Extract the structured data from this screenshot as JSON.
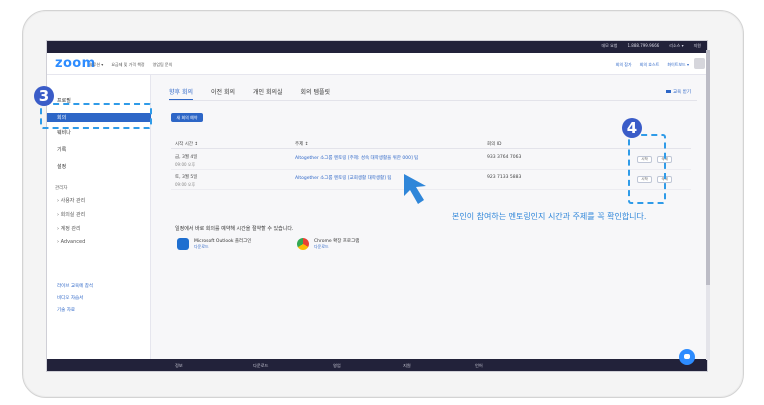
{
  "topbar": {
    "links": [
      "데모 요청",
      "1.888.799.9666",
      "리소스 ▾",
      "지원"
    ]
  },
  "header": {
    "logo": "zoom",
    "nav": [
      "솔루션 ▾",
      "요금제 및 가격 책정",
      "영업팀 문의"
    ],
    "nav_right": [
      "회의 참가",
      "회의 호스트",
      "화이트보드 ▾"
    ]
  },
  "sidebar": {
    "items": [
      {
        "label": "프로필",
        "active": false
      },
      {
        "label": "회의",
        "active": true
      },
      {
        "label": "웨비나",
        "active": false
      },
      {
        "label": "기록",
        "active": false
      },
      {
        "label": "설정",
        "active": false
      }
    ],
    "admin_label": "관리자",
    "admin_items": [
      "› 사용자 관리",
      "› 회의실 관리",
      "› 계정 관리",
      "› Advanced"
    ],
    "links": [
      "라이브 교육에 참석",
      "비디오 자습서",
      "기술 자료"
    ]
  },
  "main": {
    "tabs": [
      "향후 회의",
      "이전 회의",
      "개인 회의실",
      "회의 템플릿"
    ],
    "help_link": "교육 받기",
    "new_button": "새 회의 예약",
    "columns": [
      "시작 시간 ↕",
      "주제 ↕",
      "회의 ID"
    ],
    "rows": [
      {
        "date": "금, 3월 4일",
        "time": "09:00 오후",
        "topic": "Altogether 소그룹 멘토링 [주제: 성숙 대학생활을 위한 000] 팀",
        "id": "933 3764 7063",
        "start": "시작",
        "delete": "삭제"
      },
      {
        "date": "토, 3월 5일",
        "time": "09:00 오후",
        "topic": "Altogether 소그룹 멘토링 [교회생활 대학생활] 팀",
        "id": "923 7133 5883",
        "start": "시작",
        "delete": "삭제"
      }
    ],
    "promo": "일정에서 바로 회의를 예약해 시간을 절약할 수 있습니다.",
    "apps": [
      {
        "name": "Microsoft Outlook 플러그인",
        "sub": "다운로드"
      },
      {
        "name": "Chrome 확장 프로그램",
        "sub": "다운로드"
      }
    ]
  },
  "footer": {
    "items": [
      "정보",
      "다운로드",
      "영업",
      "지원",
      "언어"
    ]
  },
  "annotation": {
    "callout_3": "3",
    "callout_4": "4",
    "note": "본인이 참여하는 멘토링인지 시간과 주제를 꼭 확인합니다."
  },
  "colors": {
    "accent": "#2d66c7",
    "brand": "#2d8cff",
    "annotation": "#2f9be8",
    "callout": "#3a5cc8"
  }
}
